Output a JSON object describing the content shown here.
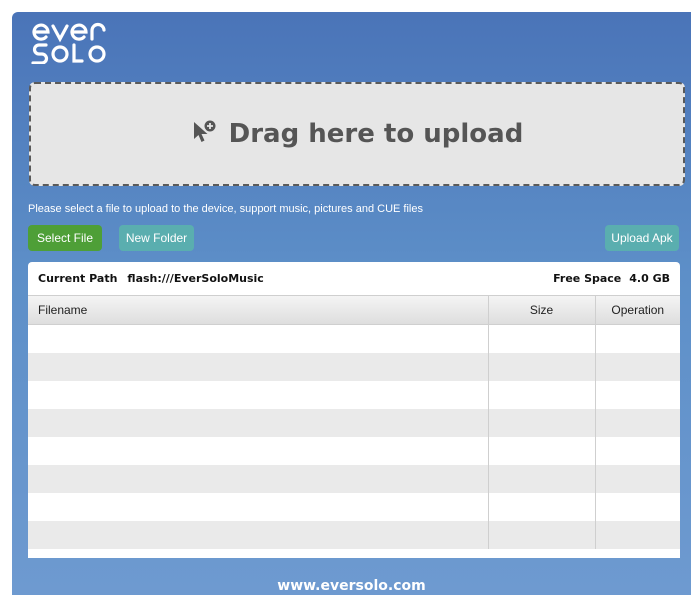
{
  "brand": {
    "logo_text": "ever solo"
  },
  "dropzone": {
    "label": "Drag here to upload",
    "icon": "cursor-add-icon"
  },
  "hint": "Please select a file to upload to the device, support music, pictures and CUE files",
  "buttons": {
    "select_file": "Select File",
    "new_folder": "New Folder",
    "upload_apk": "Upload Apk"
  },
  "path_bar": {
    "current_path_label": "Current Path",
    "current_path": "flash:///EverSoloMusic",
    "free_space_label": "Free Space",
    "free_space": "4.0 GB"
  },
  "table": {
    "columns": [
      "Filename",
      "Size",
      "Operation"
    ],
    "rows": []
  },
  "footer": "www.eversolo.com",
  "colors": {
    "background_top": "#4a74b8",
    "select_button": "#4e9f37",
    "secondary_button": "#5aaeaf"
  }
}
